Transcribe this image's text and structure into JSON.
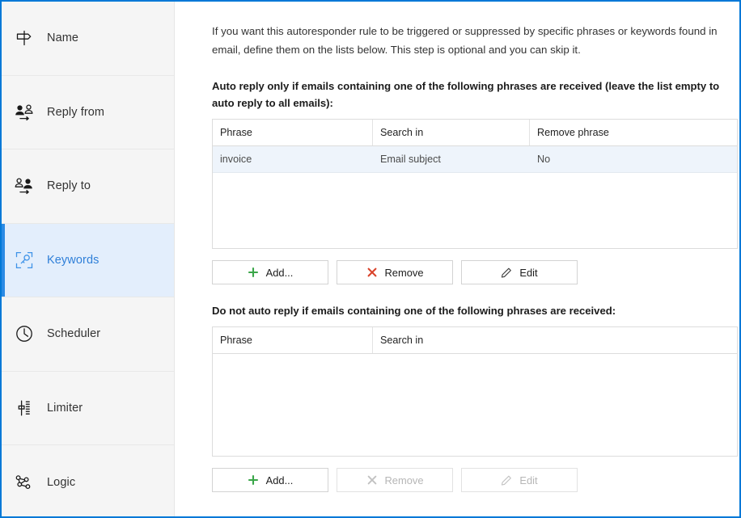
{
  "sidebar": {
    "items": [
      {
        "label": "Name",
        "icon": "signpost-icon",
        "active": false
      },
      {
        "label": "Reply from",
        "icon": "reply-from-icon",
        "active": false
      },
      {
        "label": "Reply to",
        "icon": "reply-to-icon",
        "active": false
      },
      {
        "label": "Keywords",
        "icon": "keyword-scan-icon",
        "active": true
      },
      {
        "label": "Scheduler",
        "icon": "clock-icon",
        "active": false
      },
      {
        "label": "Limiter",
        "icon": "slider-icon",
        "active": false
      },
      {
        "label": "Logic",
        "icon": "node-graph-icon",
        "active": false
      }
    ]
  },
  "main": {
    "intro": "If you want this autoresponder rule to be triggered or suppressed by specific phrases or keywords found in email, define them on the lists below. This step is optional and you can skip it.",
    "include": {
      "label": "Auto reply only if emails containing one of the following phrases are received (leave the list empty to auto reply to all emails):",
      "columns": [
        "Phrase",
        "Search in",
        "Remove phrase"
      ],
      "rows": [
        {
          "phrase": "invoice",
          "search_in": "Email subject",
          "remove_phrase": "No"
        }
      ],
      "buttons": [
        {
          "label": "Add...",
          "icon": "plus-icon",
          "enabled": true
        },
        {
          "label": "Remove",
          "icon": "cross-icon",
          "enabled": true
        },
        {
          "label": "Edit",
          "icon": "pencil-icon",
          "enabled": true
        }
      ]
    },
    "exclude": {
      "label": "Do not auto reply if emails containing one of the following phrases are received:",
      "columns": [
        "Phrase",
        "Search in"
      ],
      "rows": [],
      "buttons": [
        {
          "label": "Add...",
          "icon": "plus-icon",
          "enabled": true
        },
        {
          "label": "Remove",
          "icon": "cross-icon",
          "enabled": false
        },
        {
          "label": "Edit",
          "icon": "pencil-icon",
          "enabled": false
        }
      ]
    }
  },
  "colors": {
    "accent": "#0078d7",
    "active_nav_bg": "#e3eefc",
    "active_nav_text": "#2f7fd8",
    "row_selected_bg": "#eef4fb",
    "add_green": "#3aa649",
    "remove_red": "#d9432b"
  }
}
